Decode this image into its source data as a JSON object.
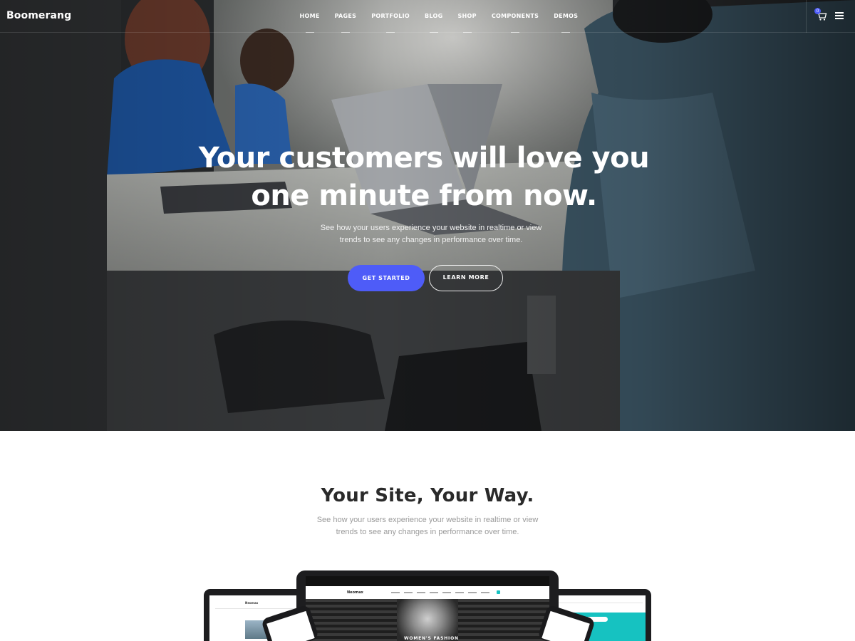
{
  "navbar": {
    "brand": "Boomerang",
    "items": [
      "HOME",
      "PAGES",
      "PORTFOLIO",
      "BLOG",
      "SHOP",
      "COMPONENTS",
      "DEMOS"
    ],
    "cart_count": "0"
  },
  "hero": {
    "title": "Your customers will love you\none minute from now.",
    "subtitle": "See how your users experience your website in realtime or view\ntrends to see any changes in performance over time.",
    "primary_button": "GET STARTED",
    "secondary_button": "LEARN MORE"
  },
  "section": {
    "title": "Your Site, Your Way.",
    "subtitle": "See how your users experience your website in realtime or view\ntrends to see any changes in performance over time."
  },
  "mockups": {
    "left_brand": "Neomax",
    "center_brand": "Neomax",
    "center_banner": "WOMEN'S FASHION"
  },
  "colors": {
    "accent": "#4e5cf8",
    "teal": "#16c2c1"
  }
}
